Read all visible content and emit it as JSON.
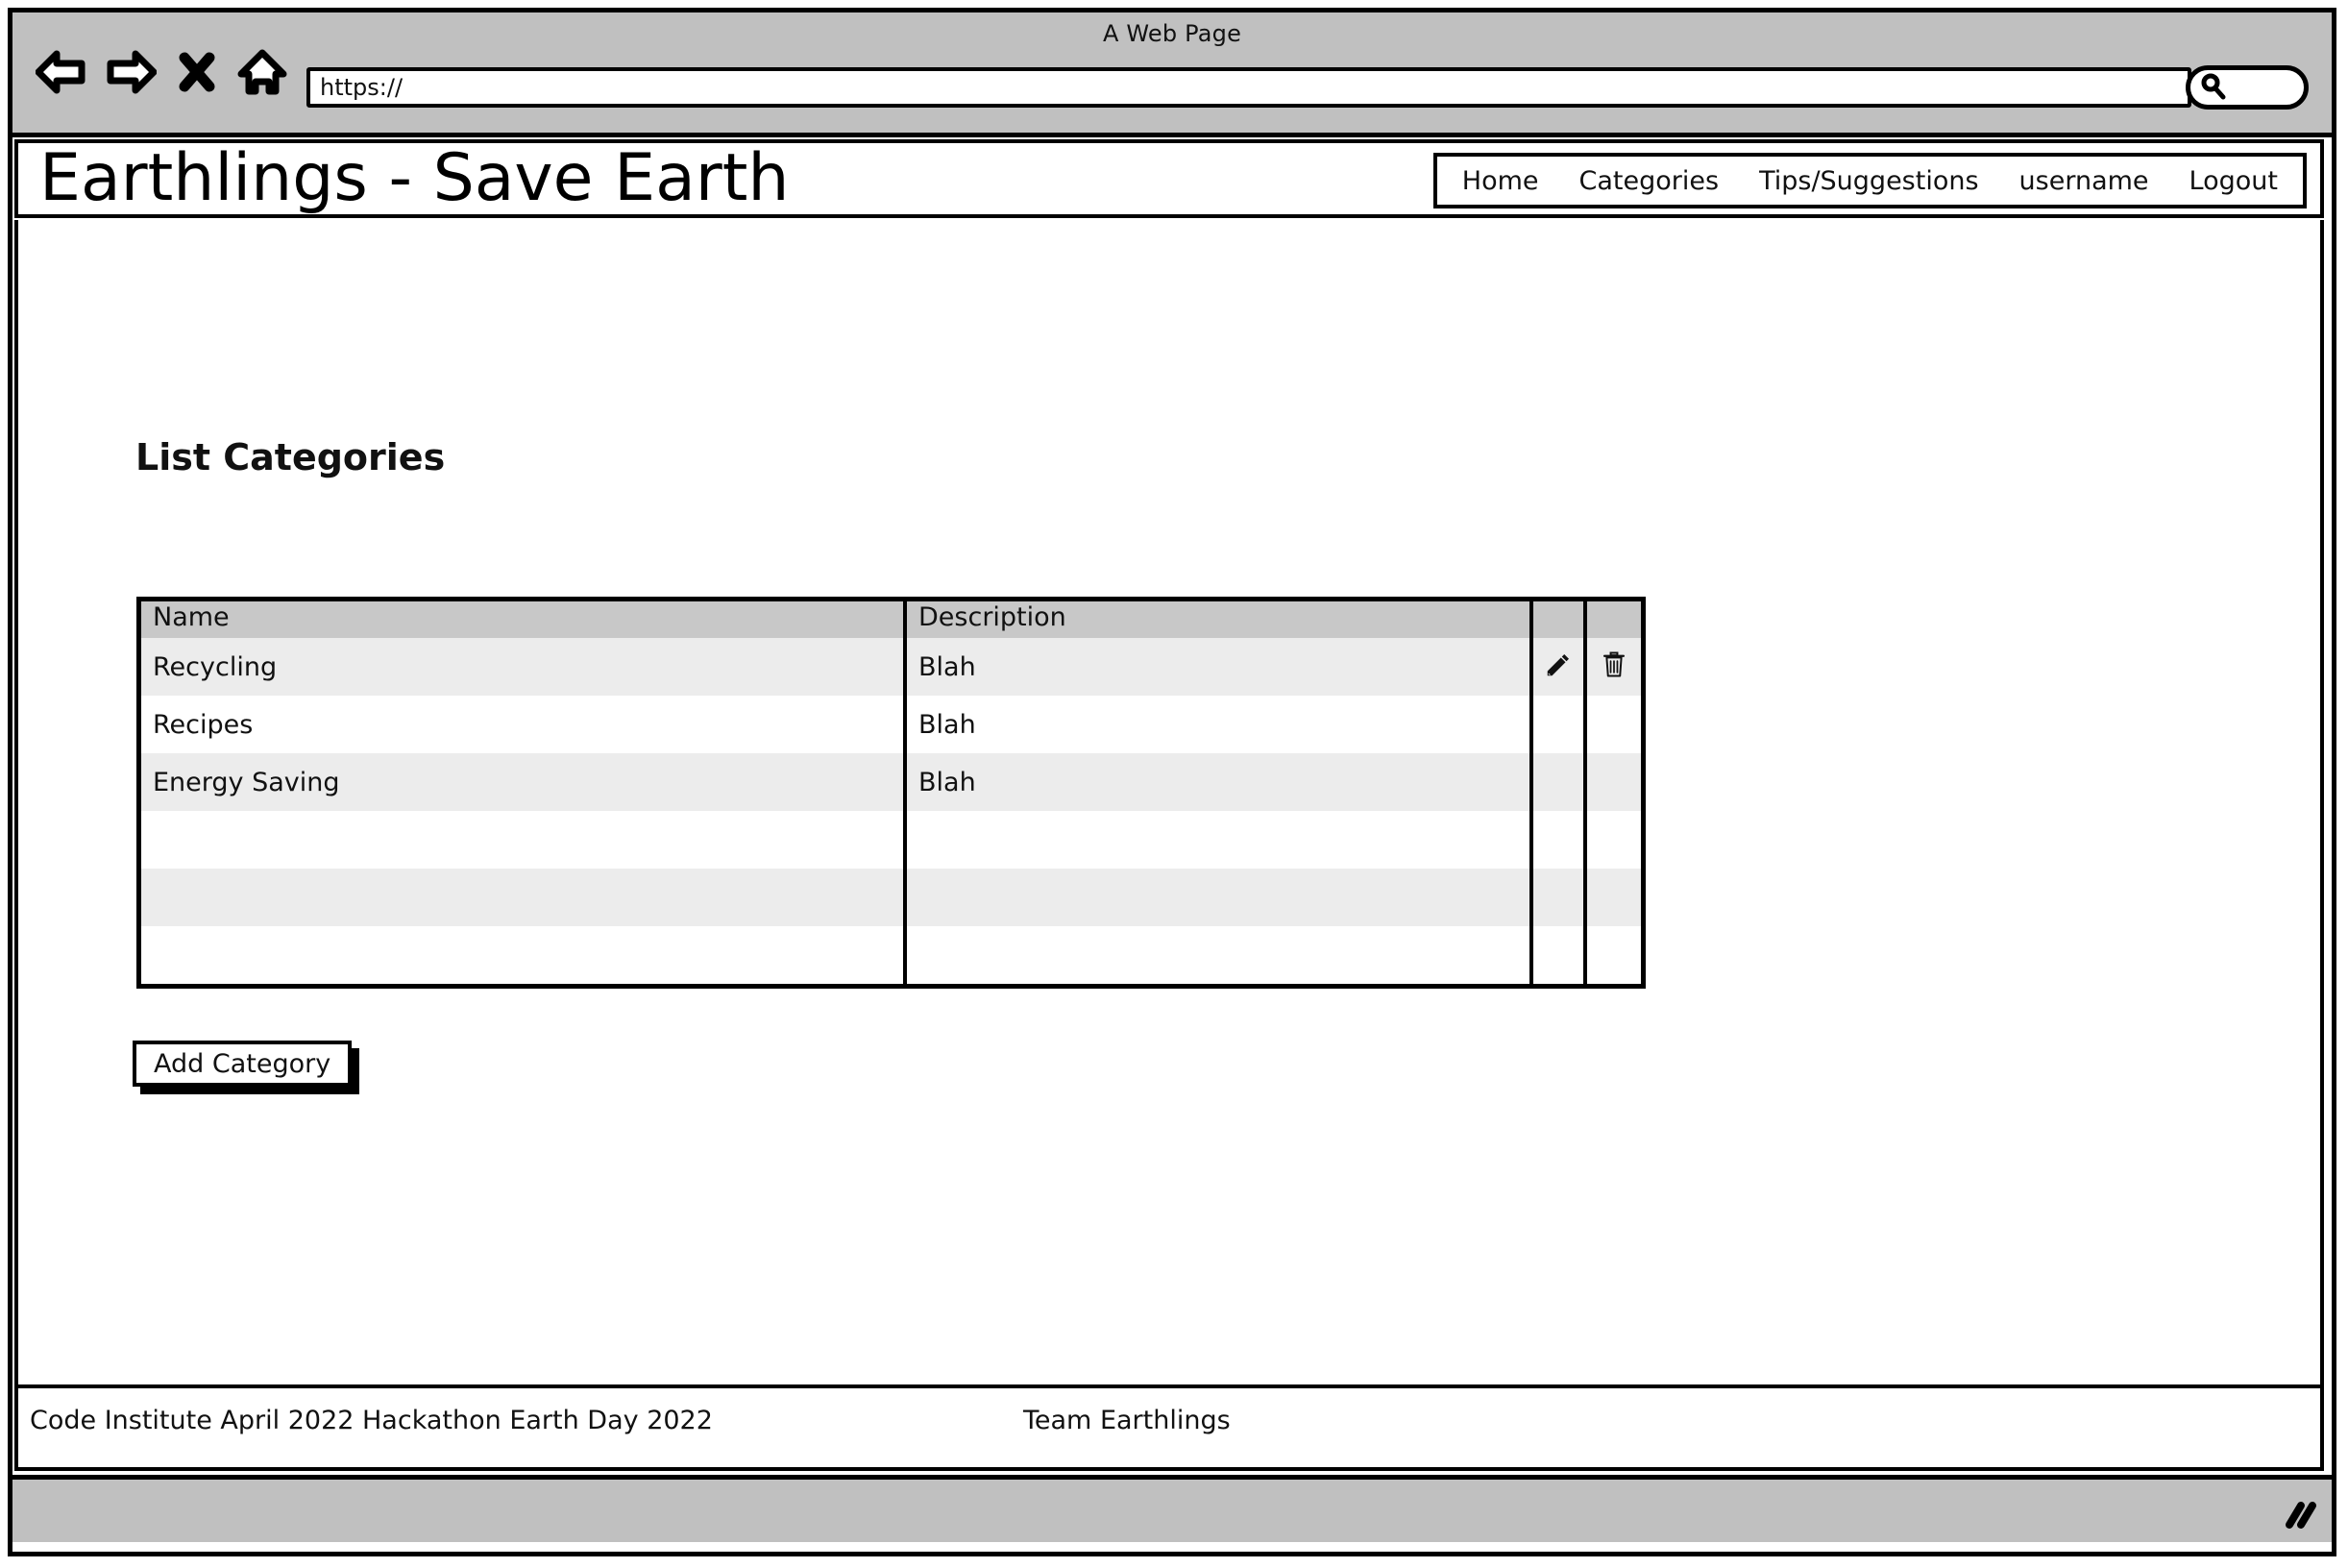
{
  "browser": {
    "window_title": "A Web Page",
    "url_value": "https://",
    "url_placeholder": "https://",
    "search_value": "",
    "icons": {
      "back": "back-arrow-icon",
      "forward": "forward-arrow-icon",
      "stop": "close-x-icon",
      "home": "home-icon",
      "search": "search-icon",
      "resize": "resize-grip-icon"
    }
  },
  "site": {
    "title": "Earthlings - Save Earth",
    "nav": [
      {
        "label": "Home"
      },
      {
        "label": "Categories"
      },
      {
        "label": "Tips/Suggestions"
      },
      {
        "label": "username"
      },
      {
        "label": "Logout"
      }
    ]
  },
  "page": {
    "heading": "List Categories",
    "table": {
      "columns": [
        "Name",
        "Description",
        "",
        ""
      ],
      "rows": [
        {
          "name": "Recycling",
          "description": "Blah",
          "has_actions": true
        },
        {
          "name": "Recipes",
          "description": "Blah",
          "has_actions": false
        },
        {
          "name": "Energy Saving",
          "description": "Blah",
          "has_actions": false
        },
        {
          "name": "",
          "description": "",
          "has_actions": false
        },
        {
          "name": "",
          "description": "",
          "has_actions": false
        },
        {
          "name": "",
          "description": "",
          "has_actions": false
        }
      ],
      "action_icons": {
        "edit": "pencil-icon",
        "delete": "trash-icon"
      }
    },
    "add_button_label": "Add Category"
  },
  "footer": {
    "left": "Code Institute April 2022 Hackathon Earth Day 2022",
    "center": "Team Earthlings"
  },
  "colors": {
    "chrome": "#c0c0c0",
    "outline": "#000000",
    "table_header": "#c8c8c8",
    "row_shaded": "#ececec",
    "row_plain": "#ffffff"
  }
}
